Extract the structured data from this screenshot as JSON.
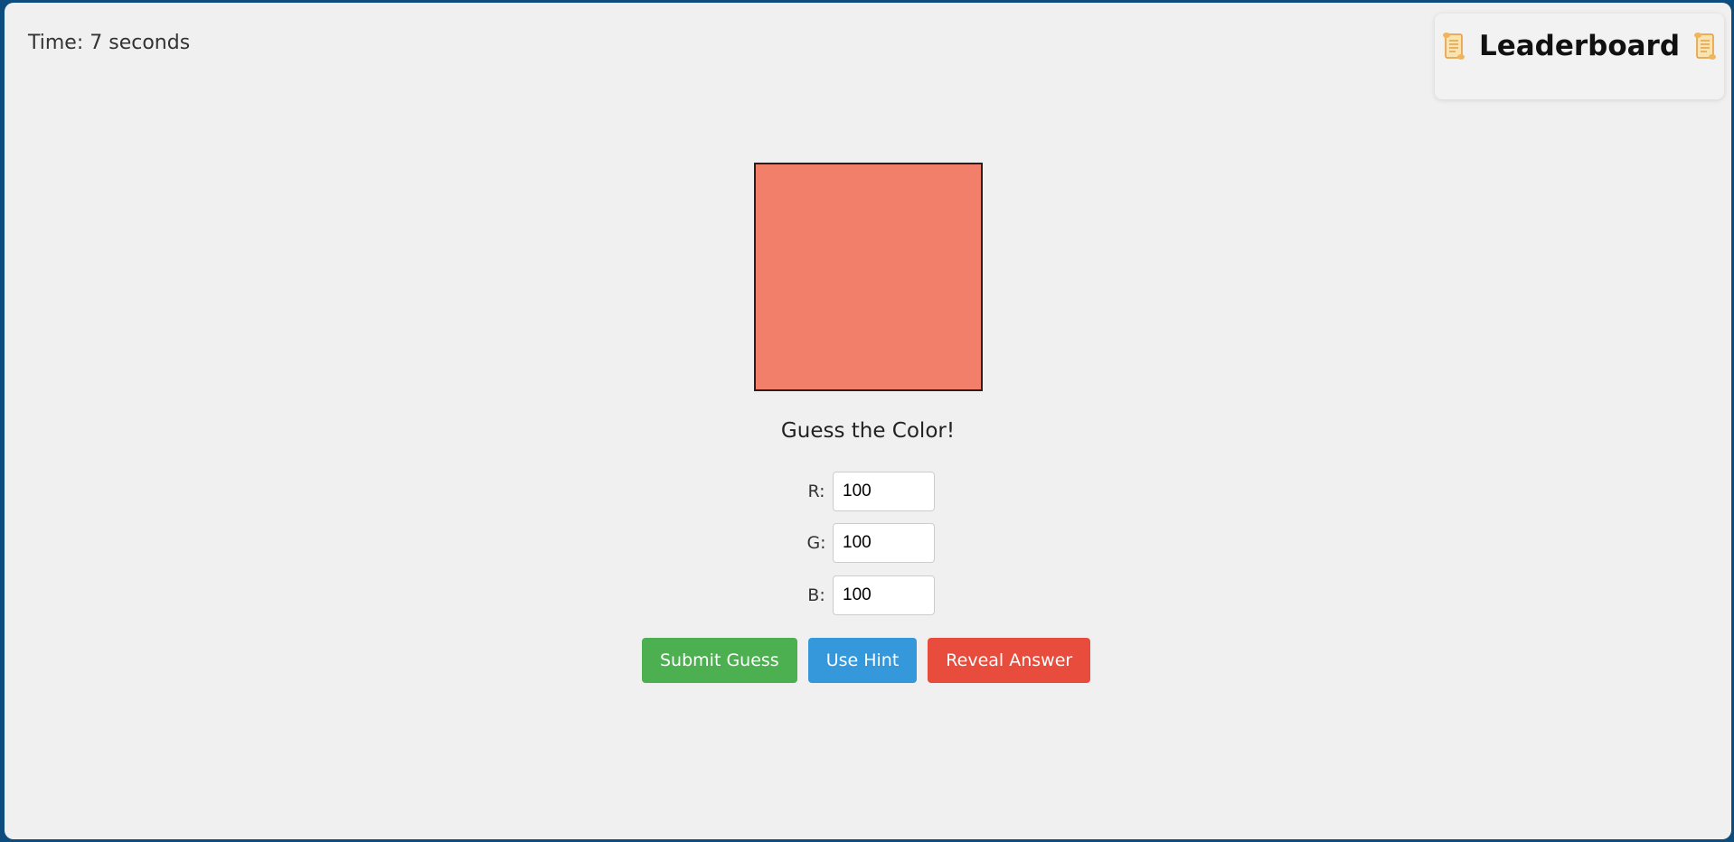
{
  "timer": {
    "label": "Time: 7 seconds"
  },
  "leaderboard": {
    "title": "Leaderboard",
    "icon": "scroll-icon"
  },
  "game": {
    "target_color": "#f27f69",
    "prompt": "Guess the Color!",
    "inputs": [
      {
        "label": "R:",
        "value": "100"
      },
      {
        "label": "G:",
        "value": "100"
      },
      {
        "label": "B:",
        "value": "100"
      }
    ]
  },
  "actions": {
    "submit_label": "Submit Guess",
    "submit_color": "#4caf50",
    "hint_label": "Use Hint",
    "hint_color": "#3498db",
    "reveal_label": "Reveal Answer",
    "reveal_color": "#e74c3c"
  }
}
